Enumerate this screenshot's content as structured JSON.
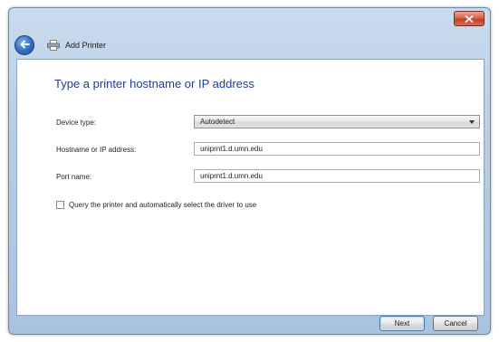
{
  "window": {
    "title": "Add Printer"
  },
  "page": {
    "heading": "Type a printer hostname or IP address"
  },
  "form": {
    "device_type": {
      "label": "Device type:",
      "value": "Autodetect"
    },
    "hostname": {
      "label": "Hostname or IP address:",
      "value": "uniprnt1.d.umn.edu"
    },
    "port": {
      "label": "Port name:",
      "value": "uniprnt1.d.umn.edu"
    },
    "query_driver": {
      "label": "Query the printer and automatically select the driver to use",
      "checked": false
    }
  },
  "buttons": {
    "next": "Next",
    "cancel": "Cancel"
  },
  "icons": {
    "close": "close-icon",
    "back": "back-arrow-icon",
    "printer": "printer-icon",
    "dropdown": "chevron-down-icon"
  },
  "colors": {
    "heading": "#1e3c9a",
    "close_button": "#c8482f",
    "back_button": "#2f6fbf"
  }
}
